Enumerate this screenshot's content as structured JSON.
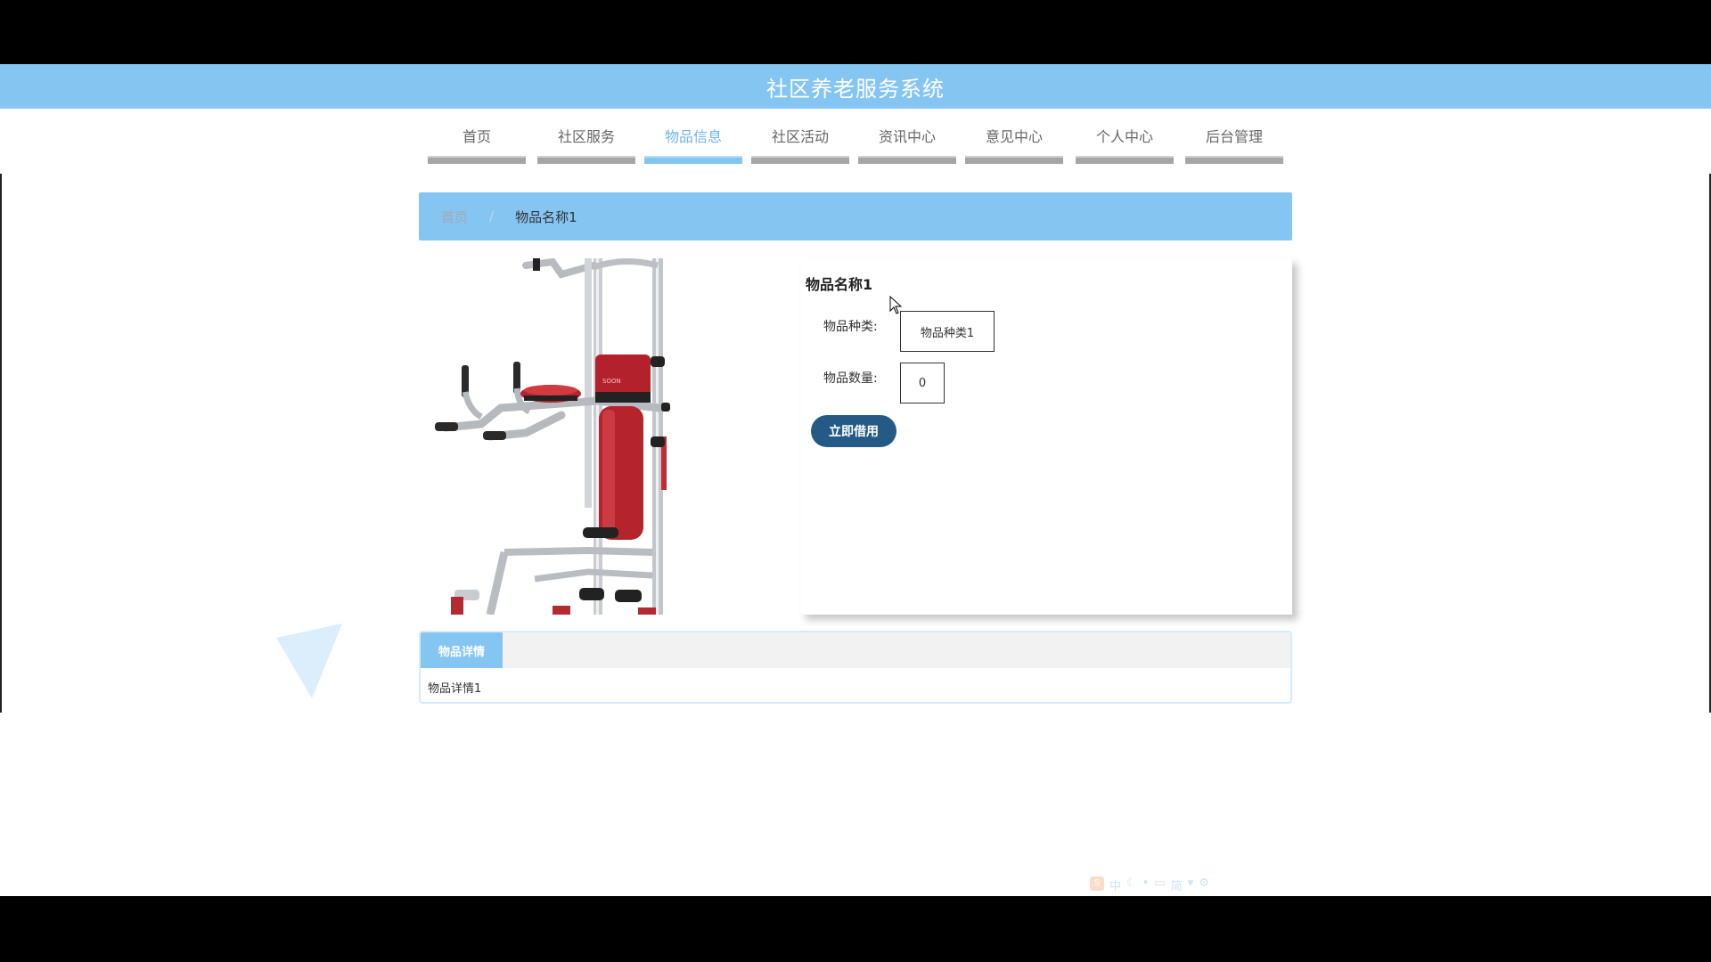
{
  "header": {
    "title": "社区养老服务系统"
  },
  "nav": {
    "items": [
      {
        "label": "首页"
      },
      {
        "label": "社区服务"
      },
      {
        "label": "物品信息"
      },
      {
        "label": "社区活动"
      },
      {
        "label": "资讯中心"
      },
      {
        "label": "意见中心"
      },
      {
        "label": "个人中心"
      },
      {
        "label": "后台管理"
      }
    ],
    "active_index": 2
  },
  "breadcrumb": {
    "home": "首页",
    "separator": "/",
    "current": "物品名称1"
  },
  "item": {
    "name": "物品名称1",
    "category_label": "物品种类:",
    "category_value": "物品种类1",
    "quantity_label": "物品数量:",
    "quantity_value": "0",
    "borrow_button": "立即借用"
  },
  "details": {
    "tab_label": "物品详情",
    "content": "物品详情1"
  },
  "ime": {
    "chars": [
      "中",
      "简"
    ]
  },
  "colors": {
    "header": "#85c5f2",
    "nav_active": "#6fb5ea",
    "button": "#245a85",
    "nav_bar": "#a6a6a6"
  }
}
